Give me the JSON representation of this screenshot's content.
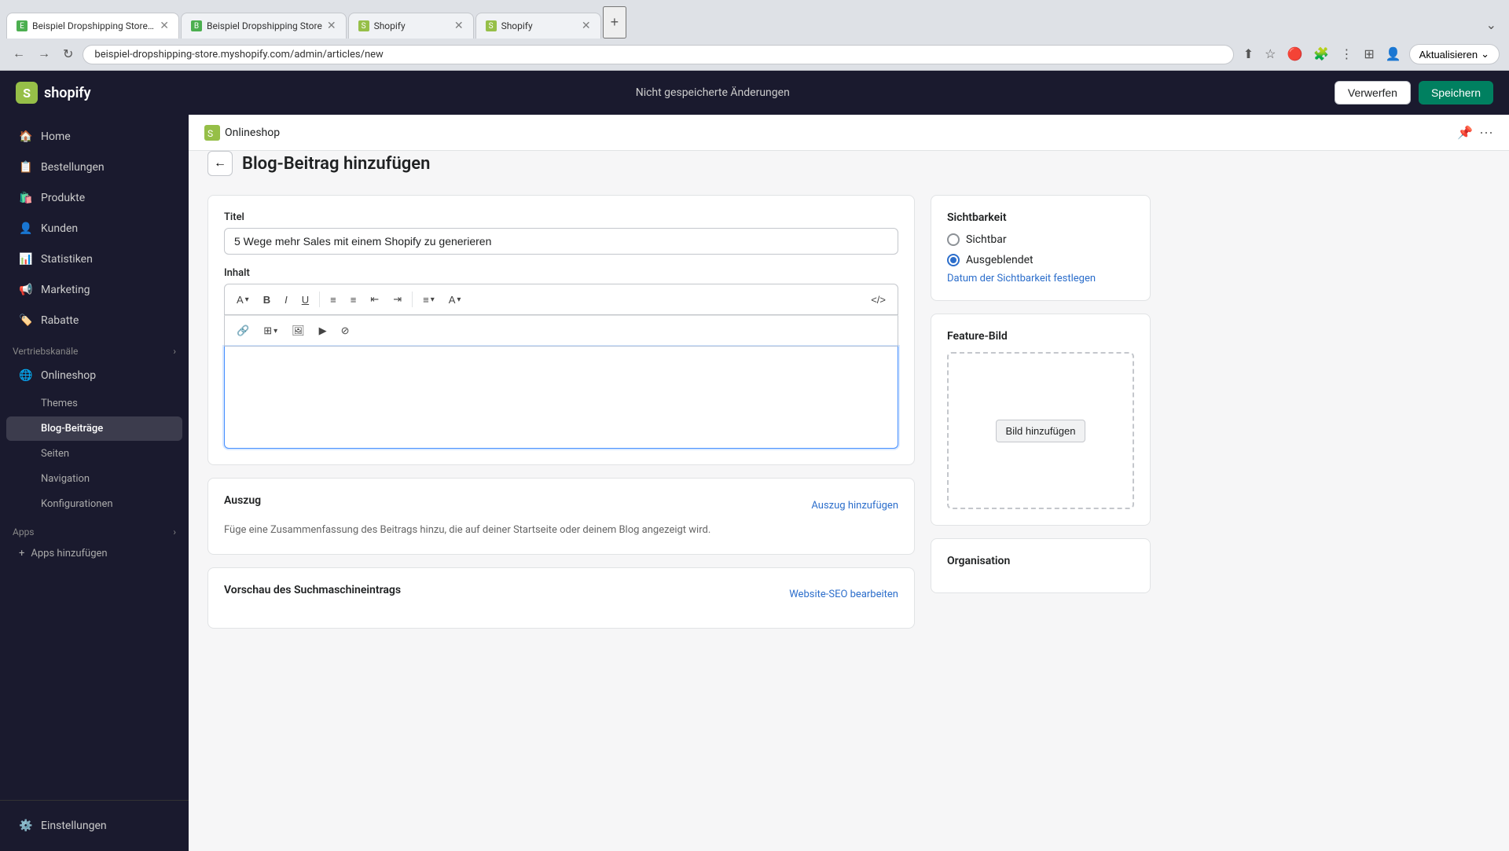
{
  "browser": {
    "tabs": [
      {
        "id": "tab1",
        "title": "Beispiel Dropshipping Store · E...",
        "favicon": "E",
        "active": true
      },
      {
        "id": "tab2",
        "title": "Beispiel Dropshipping Store",
        "favicon": "B",
        "active": false
      },
      {
        "id": "tab3",
        "title": "Shopify",
        "favicon": "S",
        "active": false
      },
      {
        "id": "tab4",
        "title": "Shopify",
        "favicon": "S",
        "active": false
      }
    ],
    "url": "beispiel-dropshipping-store.myshopify.com/admin/articles/new",
    "update_label": "Aktualisieren"
  },
  "app_header": {
    "logo_text": "shopify",
    "unsaved_label": "Nicht gespeicherte Änderungen",
    "verwerfen_label": "Verwerfen",
    "speichern_label": "Speichern"
  },
  "sidebar": {
    "items": [
      {
        "id": "home",
        "label": "Home",
        "icon": "🏠"
      },
      {
        "id": "bestellungen",
        "label": "Bestellungen",
        "icon": "📋"
      },
      {
        "id": "produkte",
        "label": "Produkte",
        "icon": "🛍️"
      },
      {
        "id": "kunden",
        "label": "Kunden",
        "icon": "👤"
      },
      {
        "id": "statistiken",
        "label": "Statistiken",
        "icon": "📊"
      },
      {
        "id": "marketing",
        "label": "Marketing",
        "icon": "📢"
      },
      {
        "id": "rabatte",
        "label": "Rabatte",
        "icon": "🏷️"
      }
    ],
    "vertriebskanaele": {
      "label": "Vertriebskanäle",
      "items": [
        {
          "id": "onlineshop",
          "label": "Onlineshop",
          "icon": "🌐"
        },
        {
          "id": "themes",
          "label": "Themes"
        },
        {
          "id": "blog-beitraege",
          "label": "Blog-Beiträge",
          "active": true
        },
        {
          "id": "seiten",
          "label": "Seiten"
        },
        {
          "id": "navigation",
          "label": "Navigation"
        },
        {
          "id": "konfigurationen",
          "label": "Konfigurationen"
        }
      ]
    },
    "apps": {
      "label": "Apps",
      "add_label": "Apps hinzufügen"
    },
    "settings_label": "Einstellungen"
  },
  "page": {
    "breadcrumb": "Onlineshop",
    "title": "Blog-Beitrag hinzufügen",
    "title_field_label": "Titel",
    "title_field_value": "5 Wege mehr Sales mit einem Shopify zu generieren",
    "content_label": "Inhalt",
    "auszug": {
      "label": "Auszug",
      "add_link": "Auszug hinzufügen",
      "description": "Füge eine Zusammenfassung des Beitrags hinzu, die auf deiner Startseite oder deinem Blog angezeigt wird."
    },
    "seo": {
      "label": "Vorschau des Suchmaschineintrags",
      "edit_link": "Website-SEO bearbeiten"
    }
  },
  "sichtbarkeit": {
    "label": "Sichtbarkeit",
    "options": [
      {
        "id": "sichtbar",
        "label": "Sichtbar",
        "checked": false
      },
      {
        "id": "ausgeblendet",
        "label": "Ausgeblendet",
        "checked": true
      }
    ],
    "date_link": "Datum der Sichtbarkeit festlegen"
  },
  "feature_bild": {
    "label": "Feature-Bild",
    "add_btn": "Bild hinzufügen"
  },
  "organisation": {
    "label": "Organisation"
  },
  "toolbar": {
    "buttons": [
      "A",
      "B",
      "I",
      "U",
      "≡",
      "≡",
      "≡",
      "≡",
      "≡",
      "<>"
    ],
    "row2_buttons": [
      "🔗",
      "⊞",
      "🖼",
      "▶",
      "⊘"
    ]
  }
}
